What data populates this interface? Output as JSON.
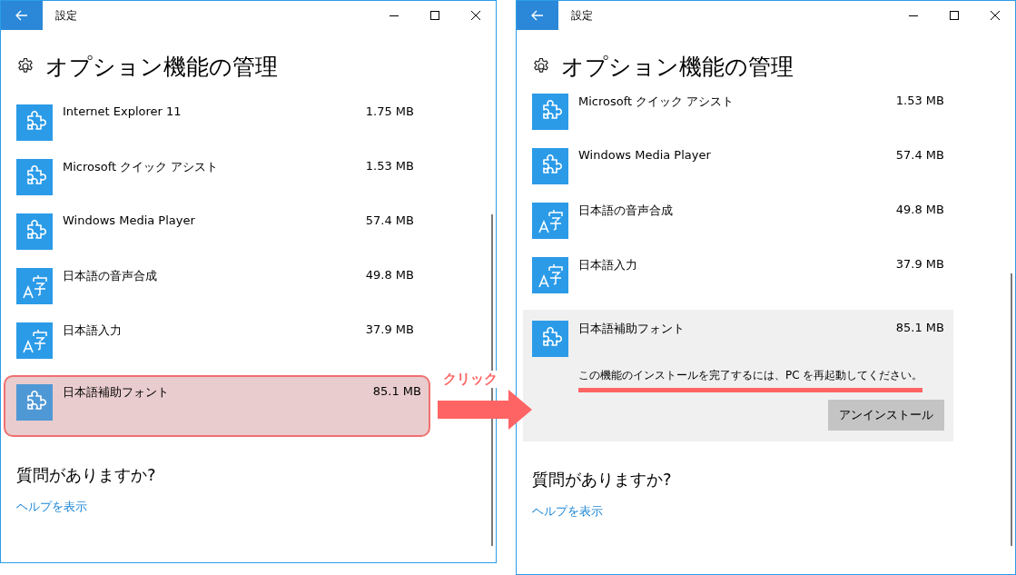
{
  "windows": [
    {
      "title": "設定",
      "heading": "オプション機能の管理",
      "features": [
        {
          "name": "Internet Explorer 11",
          "size": "1.75 MB",
          "kind": "puzzle",
          "selected": false,
          "annotated": false
        },
        {
          "name": "Microsoft クイック アシスト",
          "size": "1.53 MB",
          "kind": "puzzle",
          "selected": false,
          "annotated": false
        },
        {
          "name": "Windows Media Player",
          "size": "57.4 MB",
          "kind": "puzzle",
          "selected": false,
          "annotated": false
        },
        {
          "name": "日本語の音声合成",
          "size": "49.8 MB",
          "kind": "language",
          "selected": false,
          "annotated": false
        },
        {
          "name": "日本語入力",
          "size": "37.9 MB",
          "kind": "language",
          "selected": false,
          "annotated": false
        },
        {
          "name": "日本語補助フォント",
          "size": "85.1 MB",
          "kind": "puzzle",
          "selected": false,
          "annotated": true
        }
      ],
      "help_heading": "質問がありますか?",
      "help_link": "ヘルプを表示"
    },
    {
      "title": "設定",
      "heading": "オプション機能の管理",
      "features": [
        {
          "name": "Microsoft クイック アシスト",
          "size": "1.53 MB",
          "kind": "puzzle",
          "selected": false,
          "annotated": false
        },
        {
          "name": "Windows Media Player",
          "size": "57.4 MB",
          "kind": "puzzle",
          "selected": false,
          "annotated": false
        },
        {
          "name": "日本語の音声合成",
          "size": "49.8 MB",
          "kind": "language",
          "selected": false,
          "annotated": false
        },
        {
          "name": "日本語入力",
          "size": "37.9 MB",
          "kind": "language",
          "selected": false,
          "annotated": false
        },
        {
          "name": "日本語補助フォント",
          "size": "85.1 MB",
          "kind": "puzzle",
          "selected": true,
          "annotated": false,
          "message": "この機能のインストールを完了するには、PC を再起動してください。",
          "message_underlined": true,
          "button": "アンインストール"
        }
      ],
      "help_heading": "質問がありますか?",
      "help_link": "ヘルプを表示"
    }
  ],
  "annotation": {
    "label": "クリック"
  }
}
